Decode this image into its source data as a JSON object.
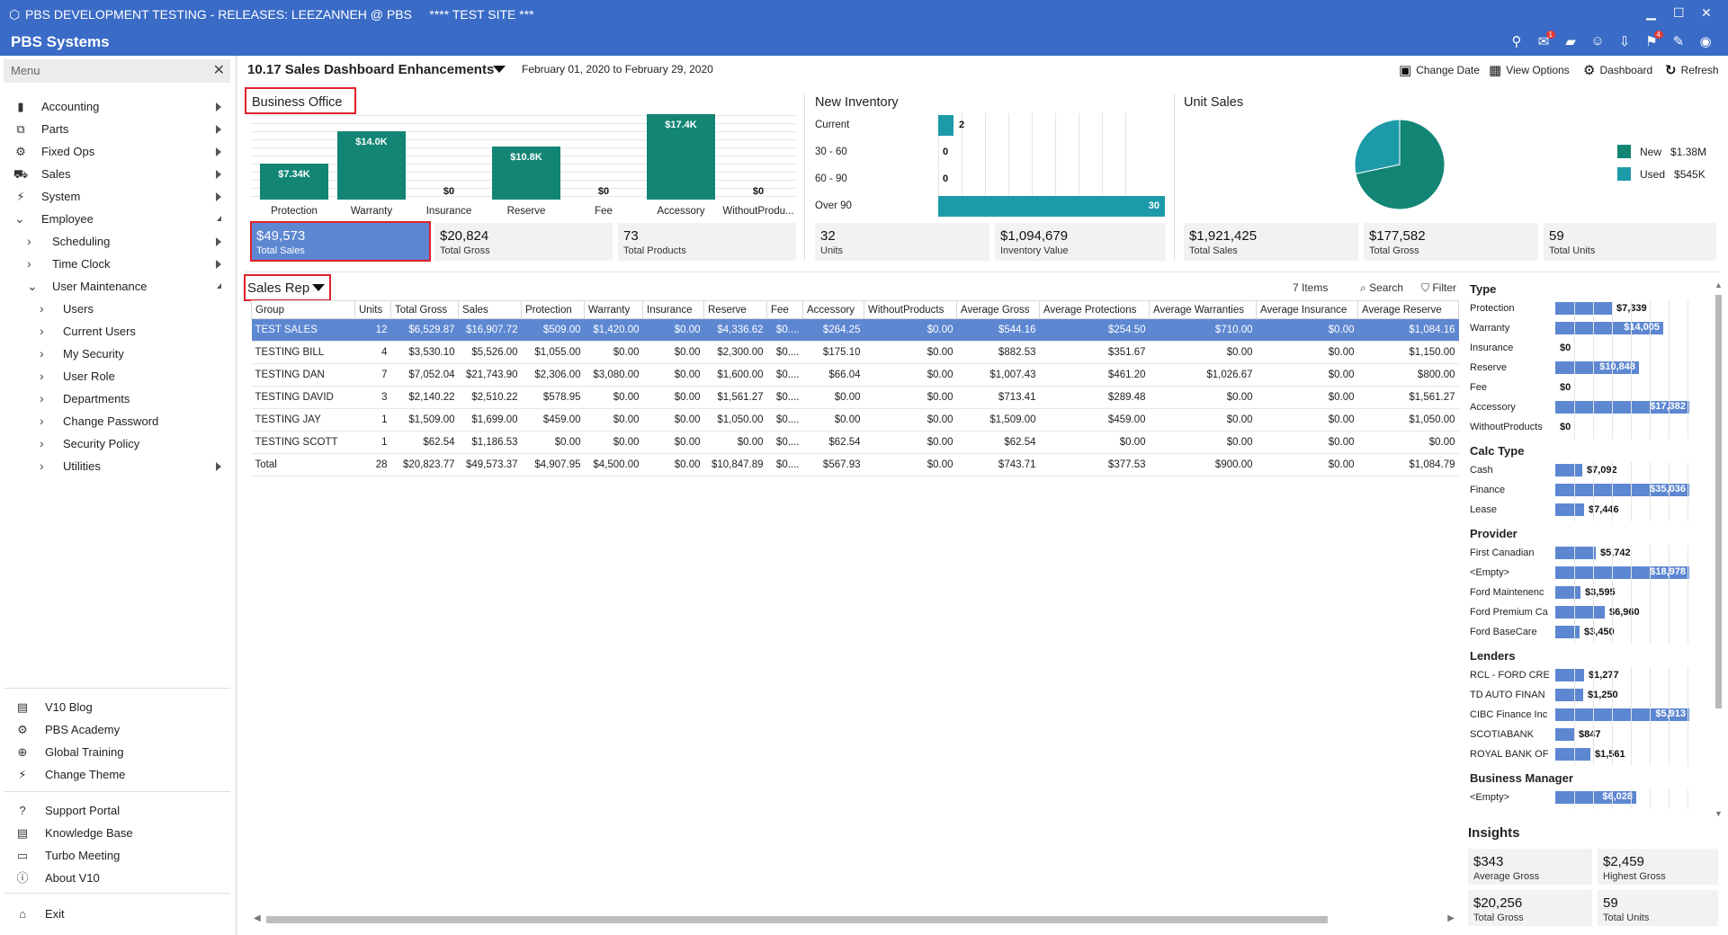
{
  "window": {
    "title": "PBS DEVELOPMENT TESTING - RELEASES: LEEZANNEH @ PBS",
    "site": "**** TEST SITE ***"
  },
  "app": {
    "brand": "PBS Systems",
    "mail_badge": "1",
    "flag_badge": "4"
  },
  "menu": {
    "header": "Menu",
    "items": [
      "Accounting",
      "Parts",
      "Fixed Ops",
      "Sales",
      "System",
      "Employee"
    ],
    "employee_sub": [
      "Scheduling",
      "Time Clock",
      "User Maintenance"
    ],
    "user_maint_sub": [
      "Users",
      "Current Users",
      "My Security",
      "User Role",
      "Departments",
      "Change Password",
      "Security Policy",
      "Utilities"
    ],
    "links1": [
      "V10 Blog",
      "PBS Academy",
      "Global Training",
      "Change Theme"
    ],
    "links2": [
      "Support Portal",
      "Knowledge Base",
      "Turbo Meeting",
      "About V10"
    ],
    "exit": "Exit"
  },
  "header": {
    "title": "10.17 Sales Dashboard Enhancements",
    "dates": "February 01, 2020 to February 29, 2020",
    "change_date": "Change Date",
    "view_options": "View Options",
    "dashboard": "Dashboard",
    "refresh": "Refresh"
  },
  "business_office": {
    "title": "Business Office",
    "stats": [
      {
        "v": "$49,573",
        "l": "Total Sales"
      },
      {
        "v": "$20,824",
        "l": "Total Gross"
      },
      {
        "v": "73",
        "l": "Total Products"
      }
    ]
  },
  "new_inventory": {
    "title": "New Inventory",
    "stats": [
      {
        "v": "32",
        "l": "Units"
      },
      {
        "v": "$1,094,679",
        "l": "Inventory Value"
      }
    ]
  },
  "unit_sales": {
    "title": "Unit Sales",
    "stats": [
      {
        "v": "$1,921,425",
        "l": "Total Sales"
      },
      {
        "v": "$177,582",
        "l": "Total Gross"
      },
      {
        "v": "59",
        "l": "Total Units"
      }
    ]
  },
  "chart_data": [
    {
      "type": "bar",
      "categories": [
        "Protection",
        "Warranty",
        "Insurance",
        "Reserve",
        "Fee",
        "Accessory",
        "WithoutProdu..."
      ],
      "values": [
        7.34,
        14.0,
        0,
        10.8,
        0,
        17.4,
        0
      ],
      "labels": [
        "$7.34K",
        "$14.0K",
        "$0",
        "$10.8K",
        "$0",
        "$17.4K",
        "$0"
      ]
    },
    {
      "type": "bar",
      "orientation": "horizontal",
      "categories": [
        "Current",
        "30 - 60",
        "60 - 90",
        "Over 90"
      ],
      "values": [
        2,
        0,
        0,
        30
      ]
    },
    {
      "type": "pie",
      "series": [
        {
          "name": "New",
          "label": "$1.38M",
          "value": 1.38
        },
        {
          "name": "Used",
          "label": "$545K",
          "value": 0.545
        }
      ],
      "colors": [
        "#138575",
        "#1d9aa8"
      ]
    }
  ],
  "sales_rep": {
    "title": "Sales Rep",
    "items": "7 Items",
    "search": "Search",
    "filter": "Filter",
    "columns": [
      "Group",
      "Units",
      "Total Gross",
      "Sales",
      "Protection",
      "Warranty",
      "Insurance",
      "Reserve",
      "Fee",
      "Accessory",
      "WithoutProducts",
      "Average Gross",
      "Average Protections",
      "Average Warranties",
      "Average Insurance",
      "Average Reserve"
    ],
    "rows": [
      [
        "TEST SALES",
        "12",
        "$6,529.87",
        "$16,907.72",
        "$509.00",
        "$1,420.00",
        "$0.00",
        "$4,336.62",
        "$0....",
        "$264.25",
        "$0.00",
        "$544.16",
        "$254.50",
        "$710.00",
        "$0.00",
        "$1,084.16"
      ],
      [
        "TESTING BILL",
        "4",
        "$3,530.10",
        "$5,526.00",
        "$1,055.00",
        "$0.00",
        "$0.00",
        "$2,300.00",
        "$0....",
        "$175.10",
        "$0.00",
        "$882.53",
        "$351.67",
        "$0.00",
        "$0.00",
        "$1,150.00"
      ],
      [
        "TESTING DAN",
        "7",
        "$7,052.04",
        "$21,743.90",
        "$2,306.00",
        "$3,080.00",
        "$0.00",
        "$1,600.00",
        "$0....",
        "$66.04",
        "$0.00",
        "$1,007.43",
        "$461.20",
        "$1,026.67",
        "$0.00",
        "$800.00"
      ],
      [
        "TESTING DAVID",
        "3",
        "$2,140.22",
        "$2,510.22",
        "$578.95",
        "$0.00",
        "$0.00",
        "$1,561.27",
        "$0....",
        "$0.00",
        "$0.00",
        "$713.41",
        "$289.48",
        "$0.00",
        "$0.00",
        "$1,561.27"
      ],
      [
        "TESTING JAY",
        "1",
        "$1,509.00",
        "$1,699.00",
        "$459.00",
        "$0.00",
        "$0.00",
        "$1,050.00",
        "$0....",
        "$0.00",
        "$0.00",
        "$1,509.00",
        "$459.00",
        "$0.00",
        "$0.00",
        "$1,050.00"
      ],
      [
        "TESTING SCOTT",
        "1",
        "$62.54",
        "$1,186.53",
        "$0.00",
        "$0.00",
        "$0.00",
        "$0.00",
        "$0....",
        "$62.54",
        "$0.00",
        "$62.54",
        "$0.00",
        "$0.00",
        "$0.00",
        "$0.00"
      ],
      [
        "Total",
        "28",
        "$20,823.77",
        "$49,573.37",
        "$4,907.95",
        "$4,500.00",
        "$0.00",
        "$10,847.89",
        "$0....",
        "$567.93",
        "$0.00",
        "$743.71",
        "$377.53",
        "$900.00",
        "$0.00",
        "$1,084.79"
      ]
    ]
  },
  "right": {
    "groups": [
      {
        "title": "Type",
        "max": 17382,
        "items": [
          [
            "Protection",
            "$7,339",
            7339
          ],
          [
            "Warranty",
            "$14,005",
            14005
          ],
          [
            "Insurance",
            "$0",
            0
          ],
          [
            "Reserve",
            "$10,848",
            10848
          ],
          [
            "Fee",
            "$0",
            0
          ],
          [
            "Accessory",
            "$17,382",
            17382
          ],
          [
            "WithoutProducts",
            "$0",
            0
          ]
        ]
      },
      {
        "title": "Calc Type",
        "max": 35036,
        "items": [
          [
            "Cash",
            "$7,092",
            7092
          ],
          [
            "Finance",
            "$35,036",
            35036
          ],
          [
            "Lease",
            "$7,446",
            7446
          ]
        ]
      },
      {
        "title": "Provider",
        "max": 18978,
        "items": [
          [
            "First Canadian",
            "$5,742",
            5742
          ],
          [
            "<Empty>",
            "$18,978",
            18978
          ],
          [
            "Ford Maintenenc",
            "$3,595",
            3595
          ],
          [
            "Ford Premium Ca",
            "$6,960",
            6960
          ],
          [
            "Ford BaseCare",
            "$3,450",
            3450
          ]
        ]
      },
      {
        "title": "Lenders",
        "max": 5913,
        "items": [
          [
            "RCL - FORD CREI",
            "$1,277",
            1277
          ],
          [
            "TD AUTO FINAN",
            "$1,250",
            1250
          ],
          [
            "CIBC Finance Inc",
            "$5,913",
            5913
          ],
          [
            "SCOTIABANK",
            "$847",
            847
          ],
          [
            "ROYAL BANK OF",
            "$1,561",
            1561
          ]
        ]
      },
      {
        "title": "Business Manager",
        "max": 10000,
        "items": [
          [
            "<Empty>",
            "$6,028",
            6028
          ]
        ]
      }
    ],
    "insights": {
      "title": "Insights",
      "stats": [
        {
          "v": "$343",
          "l": "Average Gross"
        },
        {
          "v": "$2,459",
          "l": "Highest Gross"
        },
        {
          "v": "$20,256",
          "l": "Total Gross"
        },
        {
          "v": "59",
          "l": "Total Units"
        }
      ]
    }
  },
  "colors": {
    "accent": "#3a6bc6",
    "teal": "#138575",
    "cyan": "#1d9aa8",
    "selection": "#5d87d1"
  }
}
